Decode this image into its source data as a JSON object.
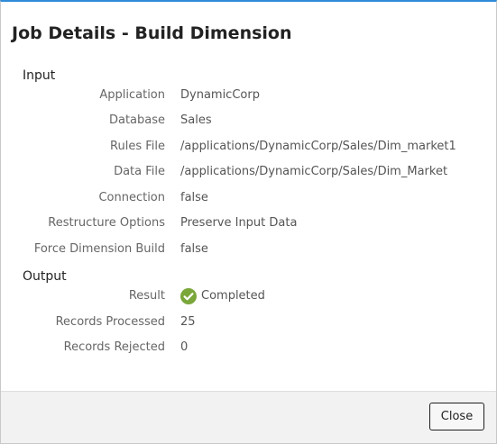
{
  "dialog": {
    "title": "Job Details - Build Dimension"
  },
  "input": {
    "heading": "Input",
    "rows": [
      {
        "label": "Application",
        "value": "DynamicCorp"
      },
      {
        "label": "Database",
        "value": "Sales"
      },
      {
        "label": "Rules File",
        "value": "/applications/DynamicCorp/Sales/Dim_market1"
      },
      {
        "label": "Data File",
        "value": "/applications/DynamicCorp/Sales/Dim_Market"
      },
      {
        "label": "Connection",
        "value": "false"
      },
      {
        "label": "Restructure Options",
        "value": "Preserve Input Data"
      },
      {
        "label": "Force Dimension Build",
        "value": "false"
      }
    ]
  },
  "output": {
    "heading": "Output",
    "result": {
      "label": "Result",
      "value": "Completed",
      "icon": "check-circle-icon",
      "icon_color": "#7aa63a"
    },
    "rows": [
      {
        "label": "Records Processed",
        "value": "25"
      },
      {
        "label": "Records Rejected",
        "value": "0"
      }
    ]
  },
  "footer": {
    "close_label": "Close"
  },
  "colors": {
    "accent_top_border": "#2f8ad8",
    "success": "#7aa63a"
  }
}
